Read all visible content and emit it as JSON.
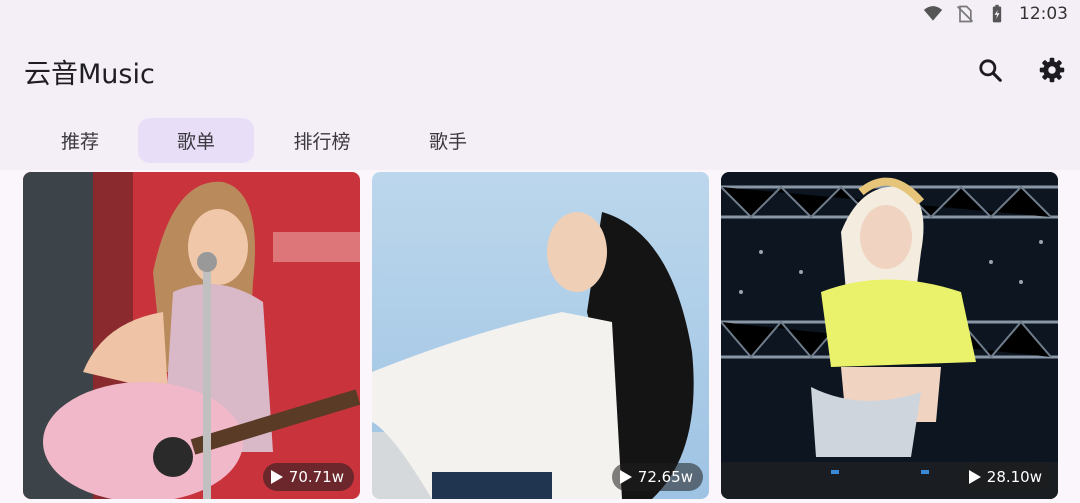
{
  "status": {
    "time": "12:03",
    "icons": [
      "wifi-icon",
      "no-sim-icon",
      "battery-icon"
    ]
  },
  "app": {
    "title": "云音Music"
  },
  "actions": {
    "search_icon": "search-icon",
    "settings_icon": "gear-icon"
  },
  "tabs": [
    {
      "label": "推荐",
      "active": false
    },
    {
      "label": "歌单",
      "active": true
    },
    {
      "label": "排行榜",
      "active": false
    },
    {
      "label": "歌手",
      "active": false
    }
  ],
  "playlists": [
    {
      "play_count": "70.71w"
    },
    {
      "play_count": "72.65w"
    },
    {
      "play_count": "28.10w"
    }
  ],
  "colors": {
    "accent": "#e8def8",
    "header_bg": "#f4eef6",
    "page_bg": "#fbf6fc"
  }
}
